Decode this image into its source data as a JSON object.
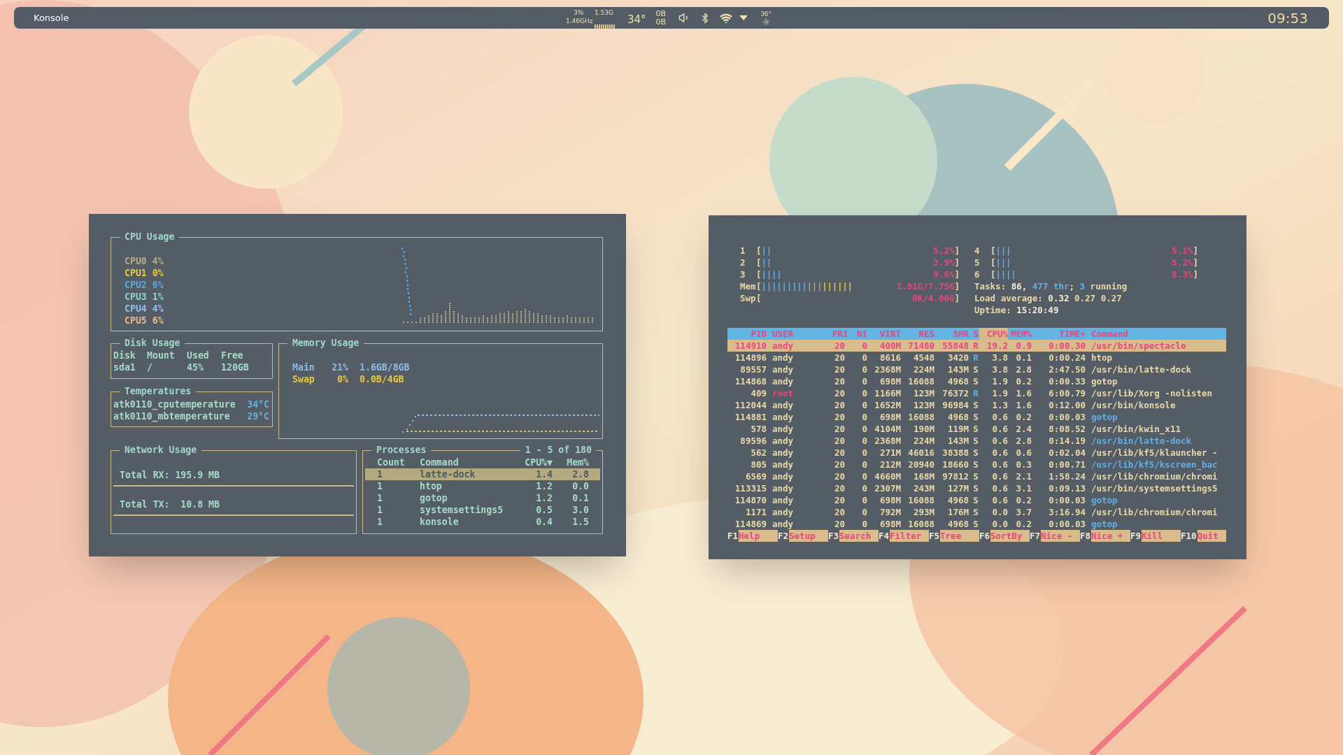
{
  "panel": {
    "app_title": "Konsole",
    "cpu_load": "3%",
    "memory": "1.53G",
    "cpu_frequency": "1.46GHz",
    "temperature": "34°",
    "upload": "0B",
    "download": "0B",
    "weather": "36°",
    "clock": "09:53"
  },
  "gotop": {
    "cpu": {
      "title": "CPU Usage",
      "cores": [
        {
          "label": "CPU0",
          "value": "4%",
          "color": "#b5ad8c"
        },
        {
          "label": "CPU1",
          "value": "0%",
          "color": "#e8c93c"
        },
        {
          "label": "CPU2",
          "value": "6%",
          "color": "#5aa9e2"
        },
        {
          "label": "CPU3",
          "value": "1%",
          "color": "#8dd3cf"
        },
        {
          "label": "CPU4",
          "value": "4%",
          "color": "#94bdea"
        },
        {
          "label": "CPU5",
          "value": "6%",
          "color": "#e3bb8f"
        }
      ]
    },
    "disk": {
      "title": "Disk Usage",
      "columns": [
        "Disk",
        "Mount",
        "Used",
        "Free"
      ],
      "rows": [
        [
          "sda1",
          "/",
          "45%",
          "120GB"
        ]
      ]
    },
    "temperatures": {
      "title": "Temperatures",
      "sensors": [
        {
          "name": "atk0110_cputemperature",
          "value": "34°C"
        },
        {
          "name": "atk0110_mbtemperature",
          "value": "29°C"
        }
      ]
    },
    "memory": {
      "title": "Memory Usage",
      "rows": [
        {
          "label": "Main",
          "percent": "21%",
          "amount": "1.6GB/8GB",
          "color": "#8bbde8"
        },
        {
          "label": "Swap",
          "percent": "0%",
          "amount": "0.0B/4GB",
          "color": "#e8c840"
        }
      ]
    },
    "network": {
      "title": "Network Usage",
      "rx": "Total RX: 195.9 MB",
      "tx": "Total TX:  10.8 MB"
    },
    "processes": {
      "title": "Processes",
      "range": "1 - 5 of 180",
      "columns": [
        "Count",
        "Command",
        "CPU%▼",
        "Mem%"
      ],
      "rows": [
        {
          "count": "1",
          "command": "latte-dock",
          "cpu": "1.4",
          "mem": "2.8",
          "selected": true
        },
        {
          "count": "1",
          "command": "htop",
          "cpu": "1.2",
          "mem": "0.0",
          "selected": false
        },
        {
          "count": "1",
          "command": "gotop",
          "cpu": "1.2",
          "mem": "0.1",
          "selected": false
        },
        {
          "count": "1",
          "command": "systemsettings5",
          "cpu": "0.5",
          "mem": "3.0",
          "selected": false
        },
        {
          "count": "1",
          "command": "konsole",
          "cpu": "0.4",
          "mem": "1.5",
          "selected": false
        }
      ]
    }
  },
  "htop": {
    "meters_left": [
      {
        "label": "1",
        "open": "[",
        "bars": [
          {
            "text": "||",
            "kind": "used"
          }
        ],
        "reading": "5.2%",
        "close": "]"
      },
      {
        "label": "2",
        "open": "[",
        "bars": [
          {
            "text": "||",
            "kind": "used"
          }
        ],
        "reading": "3.9%",
        "close": "]"
      },
      {
        "label": "3",
        "open": "[",
        "bars": [
          {
            "text": "||||",
            "kind": "used"
          }
        ],
        "reading": "9.6%",
        "close": "]"
      },
      {
        "label": "Mem",
        "open": "[",
        "bars": [
          {
            "text": "|||||||||",
            "kind": "used"
          },
          {
            "text": "|||",
            "kind": "buffers"
          },
          {
            "text": "||||||",
            "kind": "cache"
          }
        ],
        "reading": "1.81G/7.75G",
        "close": "]"
      },
      {
        "label": "Swp",
        "open": "[",
        "reading": "0K/4.00G",
        "close": "]"
      }
    ],
    "meters_right": [
      {
        "label": "4",
        "open": "[",
        "bars": [
          {
            "text": "|||",
            "kind": "used"
          }
        ],
        "reading": "5.1%",
        "close": "]"
      },
      {
        "label": "5",
        "open": "[",
        "bars": [
          {
            "text": "|||",
            "kind": "used"
          }
        ],
        "reading": "5.2%",
        "close": "]"
      },
      {
        "label": "6",
        "open": "[",
        "bars": [
          {
            "text": "||||",
            "kind": "used"
          }
        ],
        "reading": "8.3%",
        "close": "]"
      }
    ],
    "summary": [
      [
        {
          "text": "Tasks: ",
          "kind": "label"
        },
        {
          "text": "86, ",
          "kind": "value"
        },
        {
          "text": "477 thr",
          "kind": "accent"
        },
        {
          "text": "; ",
          "kind": "label"
        },
        {
          "text": "3",
          "kind": "accent"
        },
        {
          "text": " running",
          "kind": "label"
        }
      ],
      [
        {
          "text": "Load average: ",
          "kind": "label"
        },
        {
          "text": "0.32 ",
          "kind": "value"
        },
        {
          "text": "0.27 0.27",
          "kind": "label"
        }
      ],
      [
        {
          "text": "Uptime: ",
          "kind": "label"
        },
        {
          "text": "15:20:49",
          "kind": "value"
        }
      ]
    ],
    "columns": [
      {
        "label": "PID",
        "selected": false
      },
      {
        "label": "USER",
        "selected": false
      },
      {
        "label": "PRI",
        "selected": false
      },
      {
        "label": "NI",
        "selected": false
      },
      {
        "label": "VIRT",
        "selected": false
      },
      {
        "label": "RES",
        "selected": false
      },
      {
        "label": "SHR",
        "selected": false
      },
      {
        "label": "S",
        "selected": false
      },
      {
        "label": "CPU%",
        "selected": true
      },
      {
        "label": "MEM%",
        "selected": false
      },
      {
        "label": "TIME+",
        "selected": false
      },
      {
        "label": "Command",
        "selected": false
      }
    ],
    "rows": [
      {
        "pid": "114910",
        "user": "andy",
        "pri": "20",
        "ni": "0",
        "virt": "400M",
        "res": "71480",
        "shr": "55848",
        "state": "R",
        "cpu": "19.2",
        "mem": "0.9",
        "time": "0:00.30",
        "command": "/usr/bin/spectacle",
        "selected": true,
        "privileged": false,
        "running": true,
        "thread": false
      },
      {
        "pid": "114896",
        "user": "andy",
        "pri": "20",
        "ni": "0",
        "virt": "8616",
        "res": "4548",
        "shr": "3420",
        "state": "R",
        "cpu": "3.8",
        "mem": "0.1",
        "time": "0:00.24",
        "command": "htop",
        "selected": false,
        "privileged": false,
        "running": true,
        "thread": false
      },
      {
        "pid": "89557",
        "user": "andy",
        "pri": "20",
        "ni": "0",
        "virt": "2368M",
        "res": "224M",
        "shr": "143M",
        "state": "S",
        "cpu": "3.8",
        "mem": "2.8",
        "time": "2:47.50",
        "command": "/usr/bin/latte-dock",
        "selected": false,
        "privileged": false,
        "running": false,
        "thread": false
      },
      {
        "pid": "114868",
        "user": "andy",
        "pri": "20",
        "ni": "0",
        "virt": "698M",
        "res": "16088",
        "shr": "4968",
        "state": "S",
        "cpu": "1.9",
        "mem": "0.2",
        "time": "0:00.33",
        "command": "gotop",
        "selected": false,
        "privileged": false,
        "running": false,
        "thread": false
      },
      {
        "pid": "409",
        "user": "root",
        "pri": "20",
        "ni": "0",
        "virt": "1166M",
        "res": "123M",
        "shr": "76372",
        "state": "R",
        "cpu": "1.9",
        "mem": "1.6",
        "time": "6:00.79",
        "command": "/usr/lib/Xorg -nolisten",
        "selected": false,
        "privileged": true,
        "running": true,
        "thread": false
      },
      {
        "pid": "112044",
        "user": "andy",
        "pri": "20",
        "ni": "0",
        "virt": "1652M",
        "res": "123M",
        "shr": "96984",
        "state": "S",
        "cpu": "1.3",
        "mem": "1.6",
        "time": "0:12.00",
        "command": "/usr/bin/konsole",
        "selected": false,
        "privileged": false,
        "running": false,
        "thread": false
      },
      {
        "pid": "114881",
        "user": "andy",
        "pri": "20",
        "ni": "0",
        "virt": "698M",
        "res": "16088",
        "shr": "4968",
        "state": "S",
        "cpu": "0.6",
        "mem": "0.2",
        "time": "0:00.03",
        "command": "gotop",
        "selected": false,
        "privileged": false,
        "running": false,
        "thread": true
      },
      {
        "pid": "578",
        "user": "andy",
        "pri": "20",
        "ni": "0",
        "virt": "4104M",
        "res": "190M",
        "shr": "119M",
        "state": "S",
        "cpu": "0.6",
        "mem": "2.4",
        "time": "8:08.52",
        "command": "/usr/bin/kwin_x11",
        "selected": false,
        "privileged": false,
        "running": false,
        "thread": false
      },
      {
        "pid": "89596",
        "user": "andy",
        "pri": "20",
        "ni": "0",
        "virt": "2368M",
        "res": "224M",
        "shr": "143M",
        "state": "S",
        "cpu": "0.6",
        "mem": "2.8",
        "time": "0:14.19",
        "command": "/usr/bin/latte-dock",
        "selected": false,
        "privileged": false,
        "running": false,
        "thread": true
      },
      {
        "pid": "562",
        "user": "andy",
        "pri": "20",
        "ni": "0",
        "virt": "271M",
        "res": "46016",
        "shr": "38388",
        "state": "S",
        "cpu": "0.6",
        "mem": "0.6",
        "time": "0:02.04",
        "command": "/usr/lib/kf5/klauncher -",
        "selected": false,
        "privileged": false,
        "running": false,
        "thread": false
      },
      {
        "pid": "805",
        "user": "andy",
        "pri": "20",
        "ni": "0",
        "virt": "212M",
        "res": "20940",
        "shr": "18660",
        "state": "S",
        "cpu": "0.6",
        "mem": "0.3",
        "time": "0:00.71",
        "command": "/usr/lib/kf5/kscreen_bac",
        "selected": false,
        "privileged": false,
        "running": false,
        "thread": true
      },
      {
        "pid": "6569",
        "user": "andy",
        "pri": "20",
        "ni": "0",
        "virt": "4660M",
        "res": "168M",
        "shr": "97812",
        "state": "S",
        "cpu": "0.6",
        "mem": "2.1",
        "time": "1:58.24",
        "command": "/usr/lib/chromium/chromi",
        "selected": false,
        "privileged": false,
        "running": false,
        "thread": false
      },
      {
        "pid": "113315",
        "user": "andy",
        "pri": "20",
        "ni": "0",
        "virt": "2307M",
        "res": "243M",
        "shr": "127M",
        "state": "S",
        "cpu": "0.6",
        "mem": "3.1",
        "time": "0:09.13",
        "command": "/usr/bin/systemsettings5",
        "selected": false,
        "privileged": false,
        "running": false,
        "thread": false
      },
      {
        "pid": "114870",
        "user": "andy",
        "pri": "20",
        "ni": "0",
        "virt": "698M",
        "res": "16088",
        "shr": "4968",
        "state": "S",
        "cpu": "0.6",
        "mem": "0.2",
        "time": "0:00.03",
        "command": "gotop",
        "selected": false,
        "privileged": false,
        "running": false,
        "thread": true
      },
      {
        "pid": "1171",
        "user": "andy",
        "pri": "20",
        "ni": "0",
        "virt": "792M",
        "res": "293M",
        "shr": "176M",
        "state": "S",
        "cpu": "0.0",
        "mem": "3.7",
        "time": "3:16.94",
        "command": "/usr/lib/chromium/chromi",
        "selected": false,
        "privileged": false,
        "running": false,
        "thread": false
      },
      {
        "pid": "114869",
        "user": "andy",
        "pri": "20",
        "ni": "0",
        "virt": "698M",
        "res": "16088",
        "shr": "4968",
        "state": "S",
        "cpu": "0.0",
        "mem": "0.2",
        "time": "0:00.03",
        "command": "gotop",
        "selected": false,
        "privileged": false,
        "running": false,
        "thread": true
      }
    ],
    "function_keys": [
      {
        "key": "F1",
        "label": "Help"
      },
      {
        "key": "F2",
        "label": "Setup"
      },
      {
        "key": "F3",
        "label": "Search"
      },
      {
        "key": "F4",
        "label": "Filter"
      },
      {
        "key": "F5",
        "label": "Tree"
      },
      {
        "key": "F6",
        "label": "SortBy"
      },
      {
        "key": "F7",
        "label": "Nice -"
      },
      {
        "key": "F8",
        "label": "Nice +"
      },
      {
        "key": "F9",
        "label": "Kill"
      },
      {
        "key": "F10",
        "label": "Quit"
      }
    ]
  }
}
